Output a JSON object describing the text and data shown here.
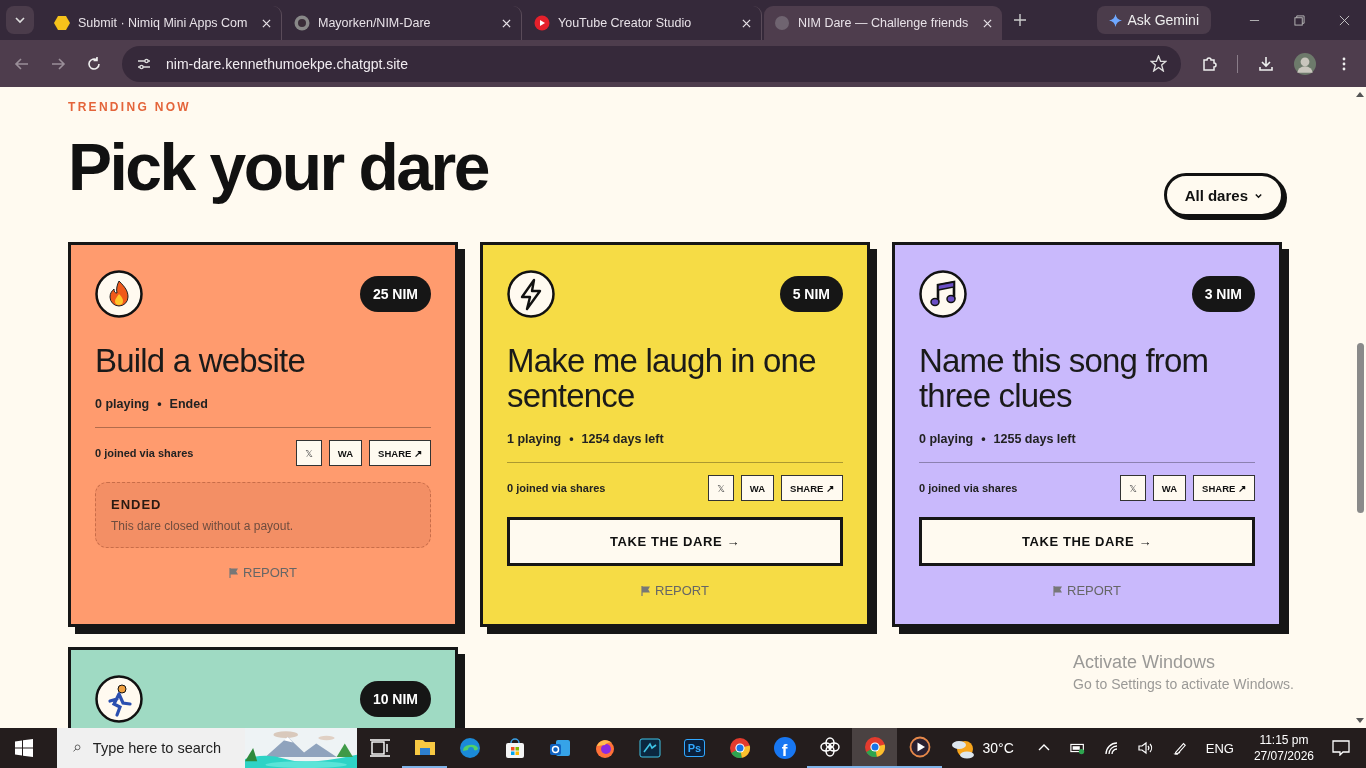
{
  "browser": {
    "tabs": [
      {
        "title": "Submit · Nimiq Mini Apps Com",
        "selected": false
      },
      {
        "title": "Mayorken/NIM-Dare",
        "selected": false
      },
      {
        "title": "YouTube Creator Studio",
        "selected": false
      },
      {
        "title": "NIM Dare — Challenge friends",
        "selected": true
      }
    ],
    "ask_gemini": "Ask Gemini",
    "address": "nim-dare.kennethumoekpe.chatgpt.site"
  },
  "page": {
    "eyebrow": "TRENDING NOW",
    "heading": "Pick your dare",
    "filter": "All dares",
    "cards": [
      {
        "kind": "ended",
        "color": "#ff9b6e",
        "reward": "25 NIM",
        "title": "Build a website",
        "playing": "0 playing",
        "separator": "•",
        "status": "Ended",
        "joined": "0 joined via shares",
        "share_buttons": [
          "𝕏",
          "WA",
          "SHARE ↗"
        ],
        "ended_title": "ENDED",
        "ended_text": "This dare closed without a payout.",
        "report": "REPORT"
      },
      {
        "kind": "open",
        "color": "#f6dc45",
        "reward": "5 NIM",
        "title": "Make me laugh in one sentence",
        "playing": "1 playing",
        "separator": "•",
        "status": "1254 days left",
        "joined": "0 joined via shares",
        "share_buttons": [
          "𝕏",
          "WA",
          "SHARE ↗"
        ],
        "action": "TAKE THE DARE →",
        "report": "REPORT"
      },
      {
        "kind": "open",
        "color": "#c9b9fc",
        "reward": "3 NIM",
        "title": "Name this song from three clues",
        "playing": "0 playing",
        "separator": "•",
        "status": "1255 days left",
        "joined": "0 joined via shares",
        "share_buttons": [
          "𝕏",
          "WA",
          "SHARE ↗"
        ],
        "action": "TAKE THE DARE →",
        "report": "REPORT"
      },
      {
        "color": "#9fdac3",
        "reward": "10 NIM"
      }
    ]
  },
  "os_notice": {
    "title": "Activate Windows",
    "text": "Go to Settings to activate Windows."
  },
  "taskbar": {
    "search_placeholder": "Type here to search",
    "apps": [
      {
        "running": false,
        "selected": false
      },
      {
        "running": true,
        "selected": false
      },
      {
        "running": false,
        "selected": false
      },
      {
        "running": false,
        "selected": false
      },
      {
        "running": false,
        "selected": false
      },
      {
        "running": false,
        "selected": false
      },
      {
        "running": false,
        "selected": false
      },
      {
        "label": "Ps",
        "running": false,
        "selected": false
      },
      {
        "running": false,
        "selected": false
      },
      {
        "label": "f",
        "running": false,
        "selected": false
      },
      {
        "running": true,
        "selected": false
      },
      {
        "running": true,
        "selected": true
      },
      {
        "running": true,
        "selected": false
      }
    ],
    "weather": "30°C",
    "language": "ENG",
    "time": "11:15 pm",
    "date": "27/07/2026"
  }
}
